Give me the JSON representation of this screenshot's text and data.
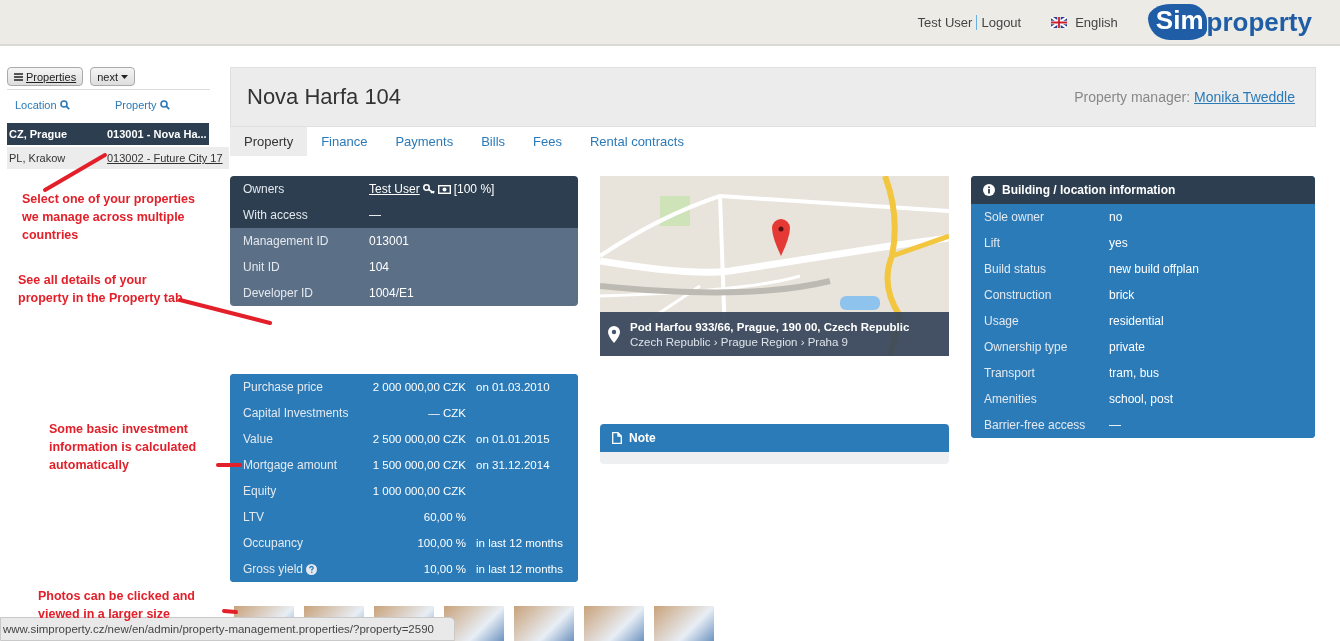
{
  "header": {
    "user": "Test User",
    "logout": "Logout",
    "language": "English",
    "logo": {
      "mark": "Sim",
      "rest": "property"
    }
  },
  "sidebar": {
    "buttons": [
      {
        "kind": "menu",
        "label": "Properties"
      },
      {
        "kind": "dropdown",
        "label": "next"
      }
    ],
    "columns": [
      "Location",
      "Property"
    ],
    "rows": [
      {
        "location": "CZ, Prague",
        "property": "013001 - Nova Ha...",
        "selected": true
      },
      {
        "location": "PL, Krakow",
        "property": "013002 - Future City 17",
        "selected": false
      }
    ]
  },
  "page": {
    "title": "Nova Harfa 104",
    "manager_label": "Property manager:",
    "manager": "Monika Tweddle"
  },
  "tabs": [
    {
      "label": "Property",
      "selected": true
    },
    {
      "label": "Finance",
      "selected": false
    },
    {
      "label": "Payments",
      "selected": false
    },
    {
      "label": "Bills",
      "selected": false
    },
    {
      "label": "Fees",
      "selected": false
    },
    {
      "label": "Rental contracts",
      "selected": false
    }
  ],
  "owners": [
    {
      "kind": "access",
      "label": "Owners",
      "value": "Test User",
      "share": "[100 %]"
    },
    {
      "kind": "access",
      "label": "With access",
      "value": "—"
    },
    {
      "kind": "id",
      "label": "Management ID",
      "value": "013001"
    },
    {
      "kind": "id",
      "label": "Unit ID",
      "value": "104"
    },
    {
      "kind": "id",
      "label": "Developer ID",
      "value": "1004/E1"
    }
  ],
  "finance": [
    {
      "label": "Purchase price",
      "amount": "2 000 000,00 CZK",
      "note": "on 01.03.2010"
    },
    {
      "label": "Capital Investments",
      "amount": "— CZK"
    },
    {
      "label": "Value",
      "amount": "2 500 000,00 CZK",
      "note": "on 01.01.2015"
    },
    {
      "label": "Mortgage amount",
      "amount": "1 500 000,00 CZK",
      "note": "on 31.12.2014"
    },
    {
      "label": "Equity",
      "amount": "1 000 000,00 CZK"
    },
    {
      "label": "LTV",
      "amount": "60,00 %"
    },
    {
      "label": "Occupancy",
      "amount": "100,00 %",
      "note": "in last 12 months"
    },
    {
      "label": "Gross yield",
      "amount": "10,00 %",
      "note": "in last 12 months",
      "help": true
    }
  ],
  "map": {
    "address": "Pod Harfou 933/66, Prague, 190 00, Czech Republic",
    "region": "Czech Republic › Prague Region › Praha 9"
  },
  "note": {
    "title": "Note"
  },
  "building": {
    "title": "Building / location information",
    "rows": [
      {
        "label": "Sole owner",
        "value": "no"
      },
      {
        "label": "Lift",
        "value": "yes"
      },
      {
        "label": "Build status",
        "value": "new build offplan"
      },
      {
        "label": "Construction",
        "value": "brick"
      },
      {
        "label": "Usage",
        "value": "residential"
      },
      {
        "label": "Ownership type",
        "value": "private"
      },
      {
        "label": "Transport",
        "value": "tram, bus"
      },
      {
        "label": "Amenities",
        "value": "school, post"
      },
      {
        "label": "Barrier-free access",
        "value": "—"
      }
    ]
  },
  "photos": [
    {
      "kind": "photo"
    },
    {
      "kind": "photo"
    },
    {
      "kind": "photo"
    },
    {
      "kind": "photo"
    },
    {
      "kind": "photo"
    },
    {
      "kind": "photo"
    },
    {
      "kind": "photo"
    }
  ],
  "status_url": "www.simproperty.cz/new/en/admin/property-management.properties/?property=2590",
  "annotations": [
    "Select one of your properties we manage across multiple countries",
    "See all details of your property in the Property tab",
    "Some basic investment information is calculated automatically",
    "Photos can be clicked and viewed in a larger size"
  ]
}
